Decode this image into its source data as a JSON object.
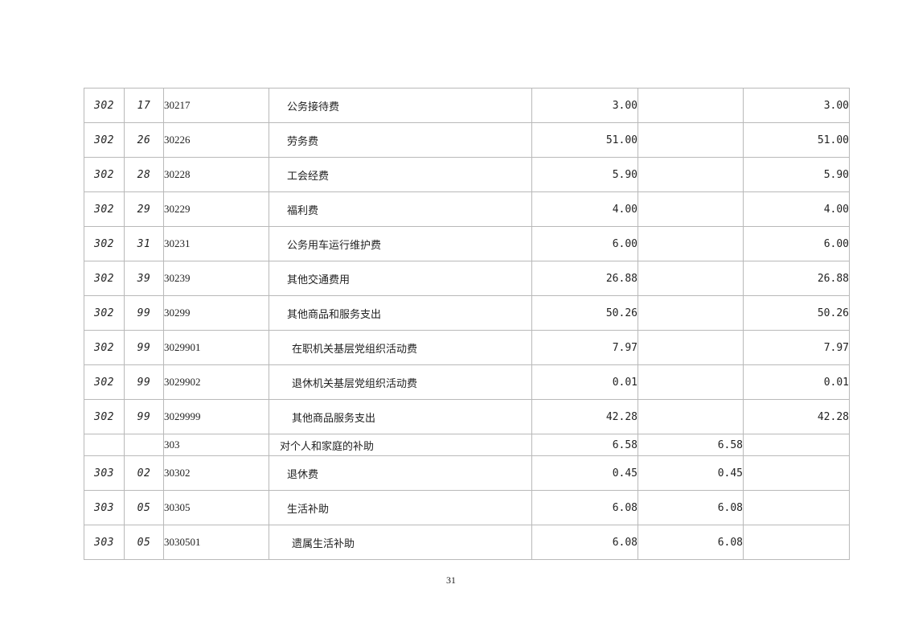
{
  "rows": [
    {
      "class": "302",
      "item": "17",
      "code": "30217",
      "name": "公务接待费",
      "total": "3.00",
      "basic": "",
      "project": "3.00"
    },
    {
      "class": "302",
      "item": "26",
      "code": "30226",
      "name": "劳务费",
      "total": "51.00",
      "basic": "",
      "project": "51.00"
    },
    {
      "class": "302",
      "item": "28",
      "code": "30228",
      "name": "工会经费",
      "total": "5.90",
      "basic": "",
      "project": "5.90"
    },
    {
      "class": "302",
      "item": "29",
      "code": "30229",
      "name": "福利费",
      "total": "4.00",
      "basic": "",
      "project": "4.00"
    },
    {
      "class": "302",
      "item": "31",
      "code": "30231",
      "name": "公务用车运行维护费",
      "total": "6.00",
      "basic": "",
      "project": "6.00"
    },
    {
      "class": "302",
      "item": "39",
      "code": "30239",
      "name": "其他交通费用",
      "total": "26.88",
      "basic": "",
      "project": "26.88"
    },
    {
      "class": "302",
      "item": "99",
      "code": "30299",
      "name": "其他商品和服务支出",
      "total": "50.26",
      "basic": "",
      "project": "50.26"
    },
    {
      "class": "302",
      "item": "99",
      "code": "3029901",
      "name": "在职机关基层党组织活动费",
      "total": "7.97",
      "basic": "",
      "project": "7.97"
    },
    {
      "class": "302",
      "item": "99",
      "code": "3029902",
      "name": "退休机关基层党组织活动费",
      "total": "0.01",
      "basic": "",
      "project": "0.01"
    },
    {
      "class": "302",
      "item": "99",
      "code": "3029999",
      "name": "其他商品服务支出",
      "total": "42.28",
      "basic": "",
      "project": "42.28"
    },
    {
      "class": "",
      "item": "",
      "code": "303",
      "name": "对个人和家庭的补助",
      "total": "6.58",
      "basic": "6.58",
      "project": ""
    },
    {
      "class": "303",
      "item": "02",
      "code": "30302",
      "name": "退休费",
      "total": "0.45",
      "basic": "0.45",
      "project": ""
    },
    {
      "class": "303",
      "item": "05",
      "code": "30305",
      "name": "生活补助",
      "total": "6.08",
      "basic": "6.08",
      "project": ""
    },
    {
      "class": "303",
      "item": "05",
      "code": "3030501",
      "name": "遗属生活补助",
      "total": "6.08",
      "basic": "6.08",
      "project": ""
    }
  ],
  "page_number": "31"
}
